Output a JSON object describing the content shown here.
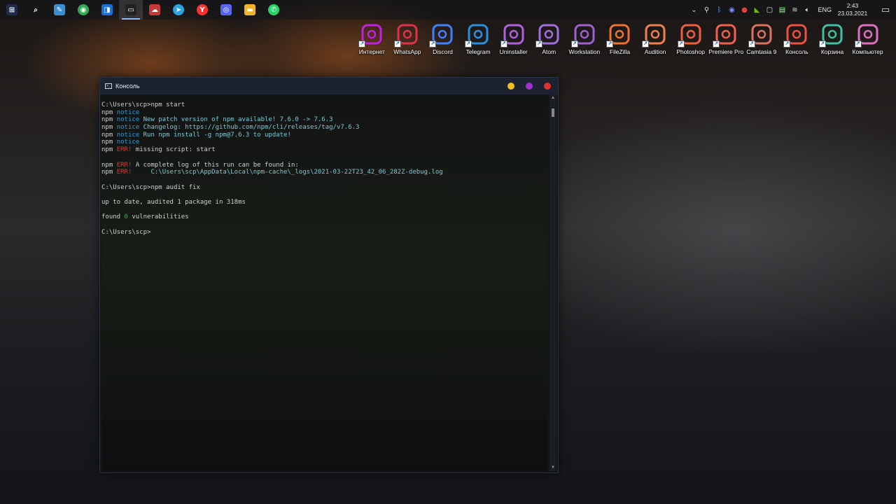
{
  "taskbar": {
    "apps": [
      {
        "name": "start-icon",
        "glyph": "⊞",
        "color": "#1e2a4a"
      },
      {
        "name": "search-icon",
        "glyph": "⌕",
        "color": "transparent"
      },
      {
        "name": "notes-icon",
        "glyph": "✎",
        "color": "#3a8fd0"
      },
      {
        "name": "chrome-icon",
        "glyph": "◉",
        "color": "#34a853"
      },
      {
        "name": "app-icon",
        "glyph": "◨",
        "color": "#1c6fd6"
      },
      {
        "name": "console-icon",
        "glyph": "▭",
        "color": "#222"
      },
      {
        "name": "cloud-icon",
        "glyph": "☁",
        "color": "#c43a3a"
      },
      {
        "name": "telegram-icon",
        "glyph": "➤",
        "color": "#2aa3df"
      },
      {
        "name": "yandex-icon",
        "glyph": "Y",
        "color": "#ff3030"
      },
      {
        "name": "discord-icon",
        "glyph": "◎",
        "color": "#5865f2"
      },
      {
        "name": "folder-icon",
        "glyph": "▬",
        "color": "#f0b429"
      },
      {
        "name": "whatsapp-icon",
        "glyph": "✆",
        "color": "#25d366"
      }
    ],
    "tray": {
      "lang": "ENG",
      "time": "2:43",
      "date": "23.03.2021"
    }
  },
  "desktop_icons": [
    {
      "label": "Интернет",
      "icon": "tor-browser-icon",
      "color": "#c020e0"
    },
    {
      "label": "WhatsApp",
      "icon": "whatsapp-icon",
      "color": "#e0304a"
    },
    {
      "label": "Discord",
      "icon": "video-camera-icon",
      "color": "#4080ff"
    },
    {
      "label": "Telegram",
      "icon": "paper-plane-icon",
      "color": "#2a8fe0"
    },
    {
      "label": "Uninstaller",
      "icon": "list-icon",
      "color": "#b060e0"
    },
    {
      "label": "Atom",
      "icon": "atom-icon",
      "color": "#a070e0"
    },
    {
      "label": "Workstation",
      "icon": "clock-icon",
      "color": "#a060d0"
    },
    {
      "label": "FileZilla",
      "icon": "cast-icon",
      "color": "#f07030"
    },
    {
      "label": "Audition",
      "icon": "music-note-icon",
      "color": "#f08050"
    },
    {
      "label": "Photoshop",
      "icon": "photoshop-icon",
      "color": "#f06040"
    },
    {
      "label": "Premiere Pro",
      "icon": "premiere-icon",
      "color": "#f06050"
    },
    {
      "label": "Camtasia 9",
      "icon": "camtasia-icon",
      "color": "#e07060"
    },
    {
      "label": "Консоль",
      "icon": "terminal-icon",
      "color": "#f05040"
    },
    {
      "label": "Корзина",
      "icon": "trash-list-icon",
      "color": "#40c0a0"
    },
    {
      "label": "Компьютер",
      "icon": "computer-icon",
      "color": "#e070c0"
    }
  ],
  "console": {
    "title": "Консоль",
    "btn_colors": [
      "#f0c020",
      "#a030d0",
      "#e03030"
    ],
    "lines": [
      [
        {
          "t": "C:\\Users\\scp>npm start",
          "c": ""
        }
      ],
      [
        {
          "t": "npm ",
          "c": ""
        },
        {
          "t": "notice",
          "c": "blue"
        }
      ],
      [
        {
          "t": "npm ",
          "c": ""
        },
        {
          "t": "notice",
          "c": "blue"
        },
        {
          "t": " New patch version of npm available! 7.6.0 -> 7.6.3",
          "c": "cyan"
        }
      ],
      [
        {
          "t": "npm ",
          "c": ""
        },
        {
          "t": "notice",
          "c": "blue"
        },
        {
          "t": " Changelog: https://github.com/npm/cli/releases/tag/v7.6.3",
          "c": "cyan"
        }
      ],
      [
        {
          "t": "npm ",
          "c": ""
        },
        {
          "t": "notice",
          "c": "blue"
        },
        {
          "t": " Run npm install -g npm@7.6.3 to update!",
          "c": "cyan"
        }
      ],
      [
        {
          "t": "npm ",
          "c": ""
        },
        {
          "t": "notice",
          "c": "blue"
        }
      ],
      [
        {
          "t": "npm ",
          "c": ""
        },
        {
          "t": "ERR!",
          "c": "red"
        },
        {
          "t": " missing script: start",
          "c": ""
        }
      ],
      [],
      [
        {
          "t": "npm ",
          "c": ""
        },
        {
          "t": "ERR!",
          "c": "red"
        },
        {
          "t": " A complete log of this run can be found in:",
          "c": ""
        }
      ],
      [
        {
          "t": "npm ",
          "c": ""
        },
        {
          "t": "ERR!",
          "c": "red"
        },
        {
          "t": "     C:\\Users\\scp\\AppData\\Local\\npm-cache\\_logs\\2021-03-22T23_42_06_282Z-debug.log",
          "c": "cyan"
        }
      ],
      [],
      [
        {
          "t": "C:\\Users\\scp>npm audit fix",
          "c": ""
        }
      ],
      [],
      [
        {
          "t": "up to date, audited 1 package in 318ms",
          "c": ""
        }
      ],
      [],
      [
        {
          "t": "found ",
          "c": ""
        },
        {
          "t": "0",
          "c": "green"
        },
        {
          "t": " vulnerabilities",
          "c": ""
        }
      ],
      [],
      [
        {
          "t": "C:\\Users\\scp>",
          "c": ""
        }
      ]
    ]
  }
}
